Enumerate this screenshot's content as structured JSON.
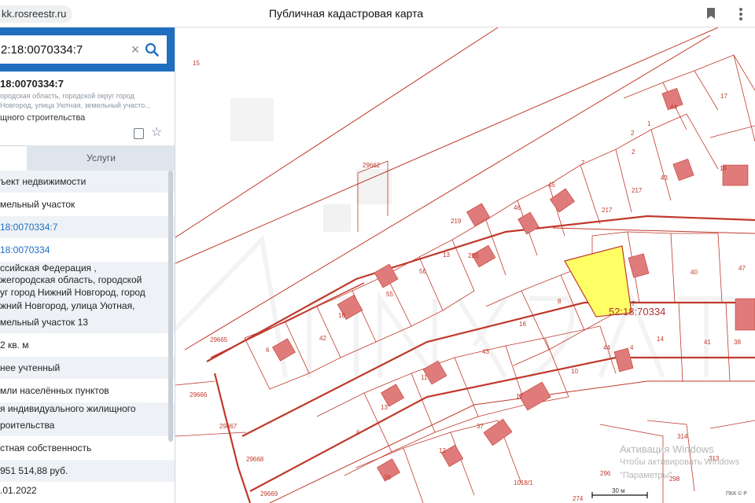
{
  "browser": {
    "url": "kk.rosreestr.ru",
    "title": "Публичная кадастровая карта"
  },
  "sidebar": {
    "search_value": "2:18:0070334:7",
    "object_title": "18:0070334:7",
    "address_line1": "ородская область, городской округ город",
    "address_line2": "Новгород, улица Уютная, земельный участо...",
    "purpose": "щного строительства",
    "tab_services": "Услуги",
    "rows": [
      {
        "text": "ъект недвижимости",
        "alt": true
      },
      {
        "text": "мельный участок",
        "alt": false
      },
      {
        "text": "18:0070334:7",
        "alt": true,
        "link": true
      },
      {
        "text": "18:0070334",
        "alt": false,
        "link": true
      },
      {
        "text": "ссийская Федерация ,",
        "alt": true
      },
      {
        "text": "жегородская область, городской",
        "alt": true
      },
      {
        "text": "уг город Нижний Новгород, город",
        "alt": true
      },
      {
        "text": "жний Новгород, улица Уютная,",
        "alt": true
      },
      {
        "text": "мельный участок 13",
        "alt": true
      },
      {
        "text": "2 кв. м",
        "alt": false
      },
      {
        "text": "нее учтенный",
        "alt": true
      },
      {
        "text": "мли населённых пунктов",
        "alt": false
      },
      {
        "text": "я индивидуального жилищного",
        "alt": true
      },
      {
        "text": "роительства",
        "alt": true
      },
      {
        "text": "стная собственность",
        "alt": false
      },
      {
        "text": "951 514,88 руб.",
        "alt": true
      },
      {
        "text": ".01.2022",
        "alt": false
      }
    ]
  },
  "map": {
    "selected_parcel_label": "52:18:70334",
    "scale_label": "30 м",
    "copyright": "ПКК © Р",
    "activation_line1": "Активация Windows",
    "activation_line2": "Чтобы активировать Windows",
    "activation_line3": "\"Параметры\".",
    "parcels": [
      "15",
      "29662",
      "29665",
      "29666",
      "29667",
      "29668",
      "29669",
      "56",
      "13",
      "219",
      "220",
      "46",
      "45",
      "7",
      "2",
      "1",
      "17",
      "44",
      "217",
      "43",
      "16",
      "226",
      "47",
      "40",
      "41",
      "38",
      "14",
      "44",
      "8",
      "16",
      "10",
      "43",
      "11",
      "55",
      "42",
      "18",
      "6",
      "13",
      "6",
      "12",
      "36",
      "37",
      "17",
      "4",
      "1018/1",
      "296",
      "298",
      "274",
      "313",
      "314",
      "52",
      "1"
    ]
  },
  "colors": {
    "accent": "#1f6ebf",
    "parcel_line": "#c0392b",
    "building": "#e07b7b",
    "selected_fill": "#ffff66"
  }
}
